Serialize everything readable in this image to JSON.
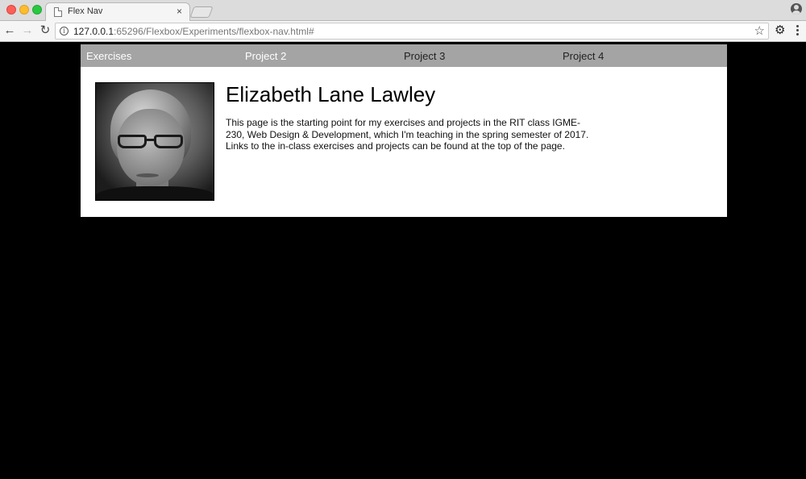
{
  "browser": {
    "tab_title": "Flex Nav",
    "tab_close": "×",
    "url_host": "127.0.0.1",
    "url_rest": ":65296/Flexbox/Experiments/flexbox-nav.html#",
    "icons": [
      "back-arrow-icon",
      "forward-arrow-icon",
      "reload-icon",
      "info-icon",
      "star-icon",
      "extension-icon",
      "menu-icon",
      "profile-icon",
      "page-icon"
    ]
  },
  "site": {
    "nav": [
      {
        "label": "Exercises"
      },
      {
        "label": "Project 2"
      },
      {
        "label": "Project 3"
      },
      {
        "label": "Project 4"
      }
    ],
    "title": "Elizabeth Lane Lawley",
    "bio": "This page is the starting point for my exercises and projects in the RIT class IGME-230, Web Design & Development, which I'm teaching in the spring semester of 2017. Links to the in-class exercises and projects can be found at the top of the page."
  },
  "colors": {
    "page_background": "#000000",
    "nav_background": "#a4a4a4",
    "content_background": "#ffffff"
  }
}
